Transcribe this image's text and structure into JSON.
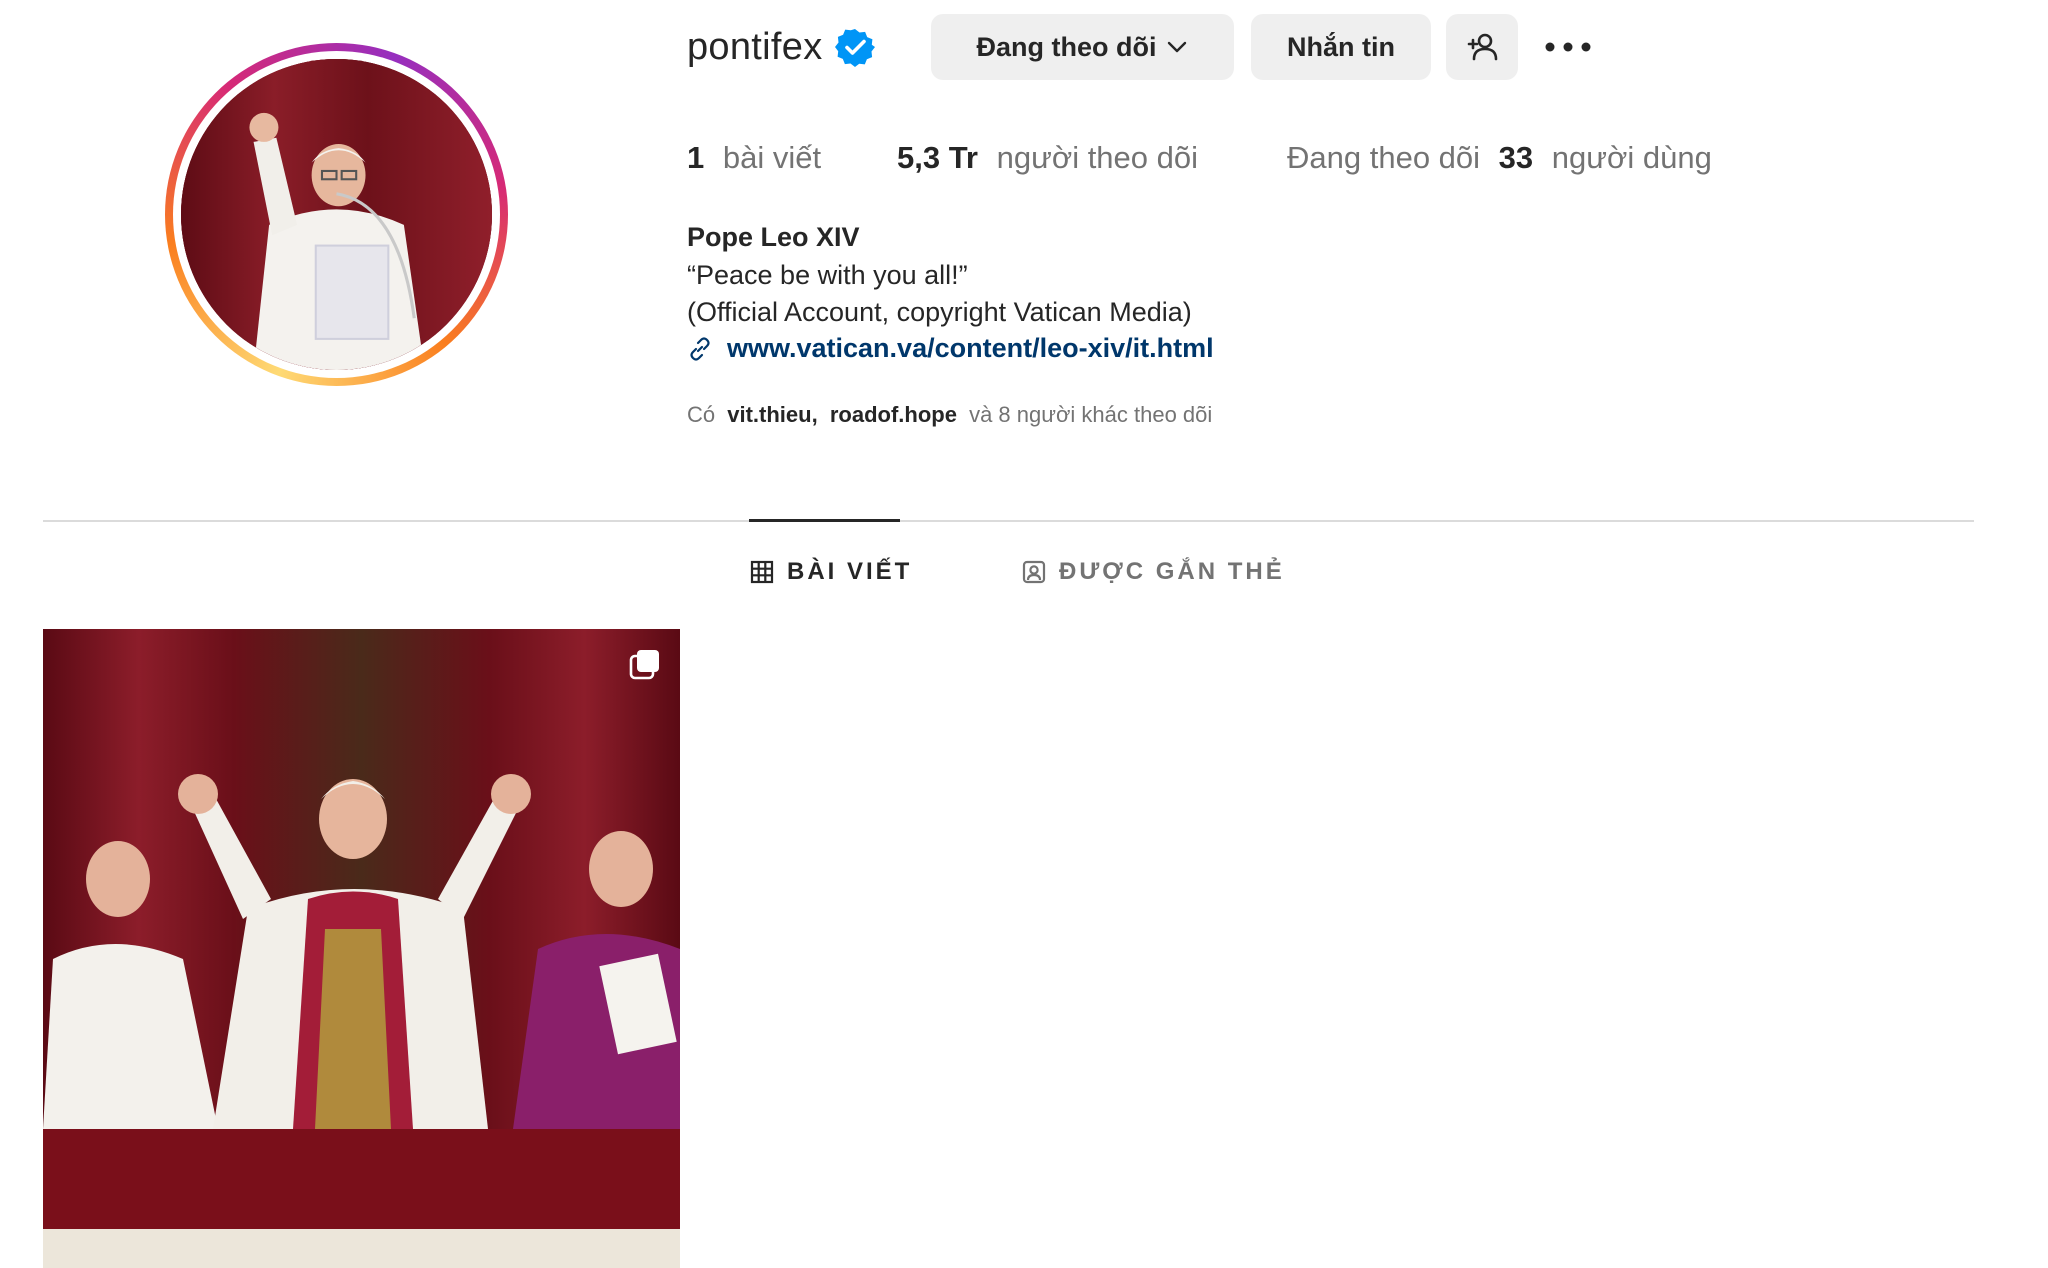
{
  "profile": {
    "username": "pontifex",
    "verified_icon": "verified-badge-icon",
    "following_button_label": "Đang theo dõi",
    "message_button_label": "Nhắn tin",
    "add_user_icon": "add-user-icon",
    "more_icon": "more-options-icon"
  },
  "stats": {
    "posts_count": "1",
    "posts_label": "bài viết",
    "followers_count": "5,3 Tr",
    "followers_label": "người theo dõi",
    "following_prefix": "Đang theo dõi",
    "following_count": "33",
    "following_label": "người dùng"
  },
  "bio": {
    "name": "Pope Leo XIV",
    "line1": "“Peace be with you all!”",
    "line2": "(Official Account, copyright Vatican Media)",
    "link": "www.vatican.va/content/leo-xiv/it.html"
  },
  "followed_by": {
    "prefix": "Có",
    "user1": "vit.thieu",
    "separator": ",",
    "user2": "roadof.hope",
    "suffix": "và 8 người khác theo dõi"
  },
  "tabs": [
    {
      "label": "BÀI VIẾT",
      "icon": "grid-icon",
      "active": true
    },
    {
      "label": "ĐƯỢC GẮN THẺ",
      "icon": "tagged-user-icon",
      "active": false
    }
  ],
  "colors": {
    "link": "#00376b",
    "muted": "#737373",
    "button_bg": "#efefef",
    "verified": "#0095f6"
  }
}
